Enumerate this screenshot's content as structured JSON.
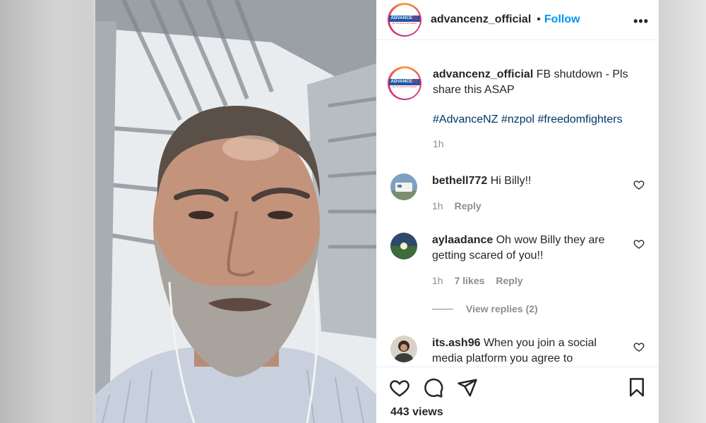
{
  "post": {
    "username": "advancenz_official",
    "follow_label": "Follow",
    "separator": "•",
    "more_label": "•••",
    "logo_text": "ADVANCE",
    "logo_nz": "NZ",
    "logo_subtext": "WE THE PEOPLE MOVEMENT"
  },
  "caption": {
    "username": "advancenz_official",
    "text": "FB shutdown - Pls share this ASAP",
    "hashtags": "#AdvanceNZ #nzpol #freedomfighters",
    "time": "1h"
  },
  "comments": [
    {
      "username": "bethell772",
      "text": "Hi Billy!!",
      "time": "1h",
      "likes": "",
      "reply_label": "Reply"
    },
    {
      "username": "aylaadance",
      "text": "Oh wow Billy they are getting scared of you!!",
      "time": "1h",
      "likes": "7 likes",
      "reply_label": "Reply",
      "view_replies": "View replies (2)"
    },
    {
      "username": "its.ash96",
      "text": "When you join a social media platform you agree to",
      "time": "",
      "likes": "",
      "reply_label": ""
    }
  ],
  "footer": {
    "views": "443 views"
  },
  "icons": {
    "like": "heart-icon",
    "comment": "comment-icon",
    "share": "paper-plane-icon",
    "save": "bookmark-icon"
  },
  "colors": {
    "accent": "#0095f6",
    "hashtag": "#00376b",
    "muted": "#8e8e8e",
    "text": "#262626"
  }
}
